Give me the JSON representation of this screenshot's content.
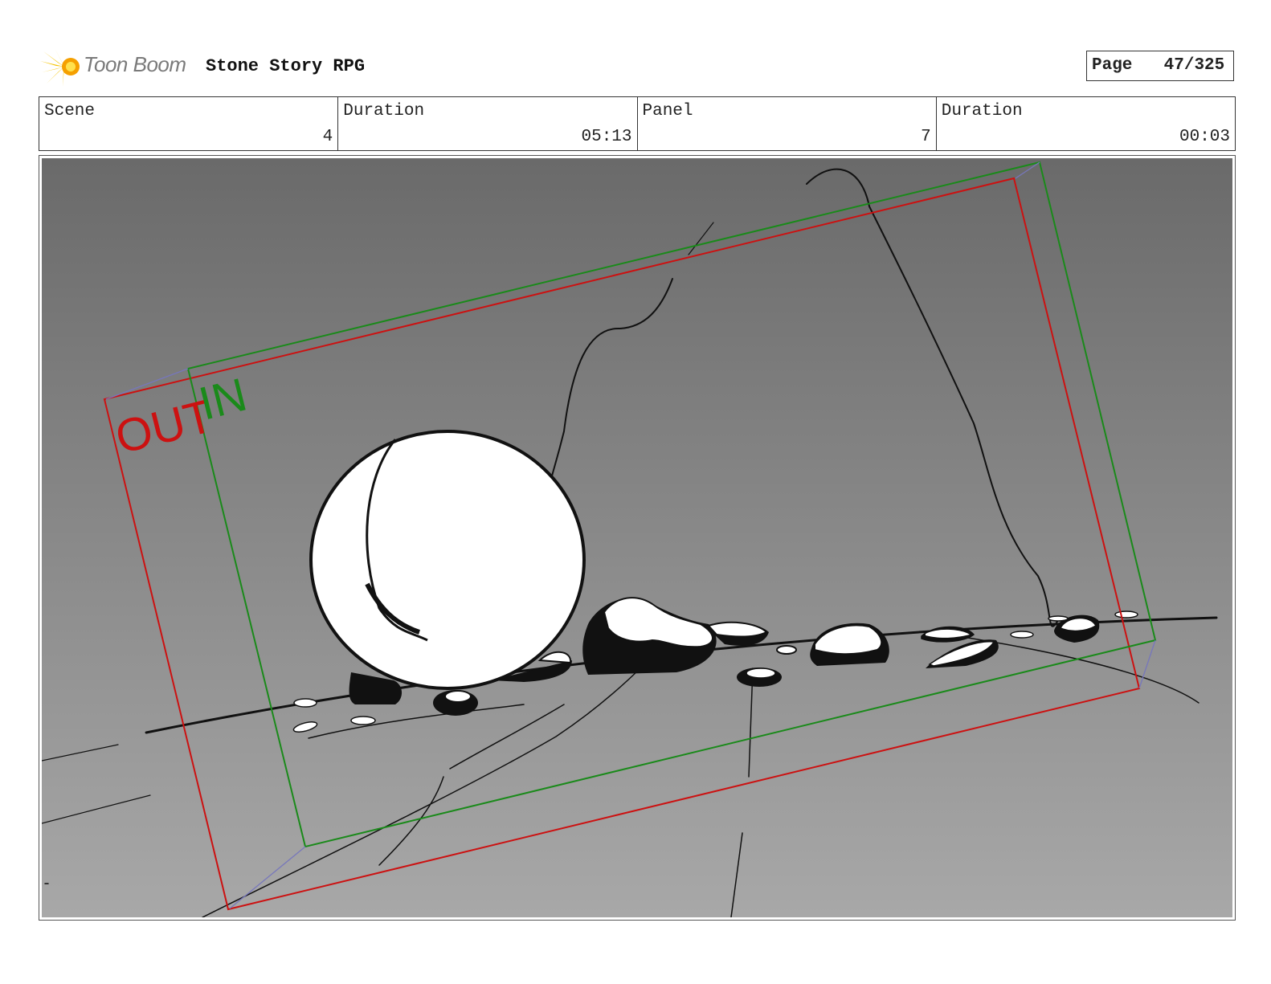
{
  "header": {
    "logo_text": "Toon Boom",
    "project_title": "Stone Story RPG",
    "page_label": "Page",
    "page_value": "47/325"
  },
  "info": {
    "scene_label": "Scene",
    "scene_value": "4",
    "scene_duration_label": "Duration",
    "scene_duration_value": "05:13",
    "panel_label": "Panel",
    "panel_value": "7",
    "panel_duration_label": "Duration",
    "panel_duration_value": "00:03"
  },
  "panel": {
    "camera_out_label": "OUT",
    "camera_in_label": "IN",
    "colors": {
      "camera_out": "#cc1111",
      "camera_in": "#1a8a1a",
      "camera_motion": "#7777bb",
      "sky_top": "#6a6a6a",
      "sky_bottom": "#a8a8a8"
    }
  }
}
